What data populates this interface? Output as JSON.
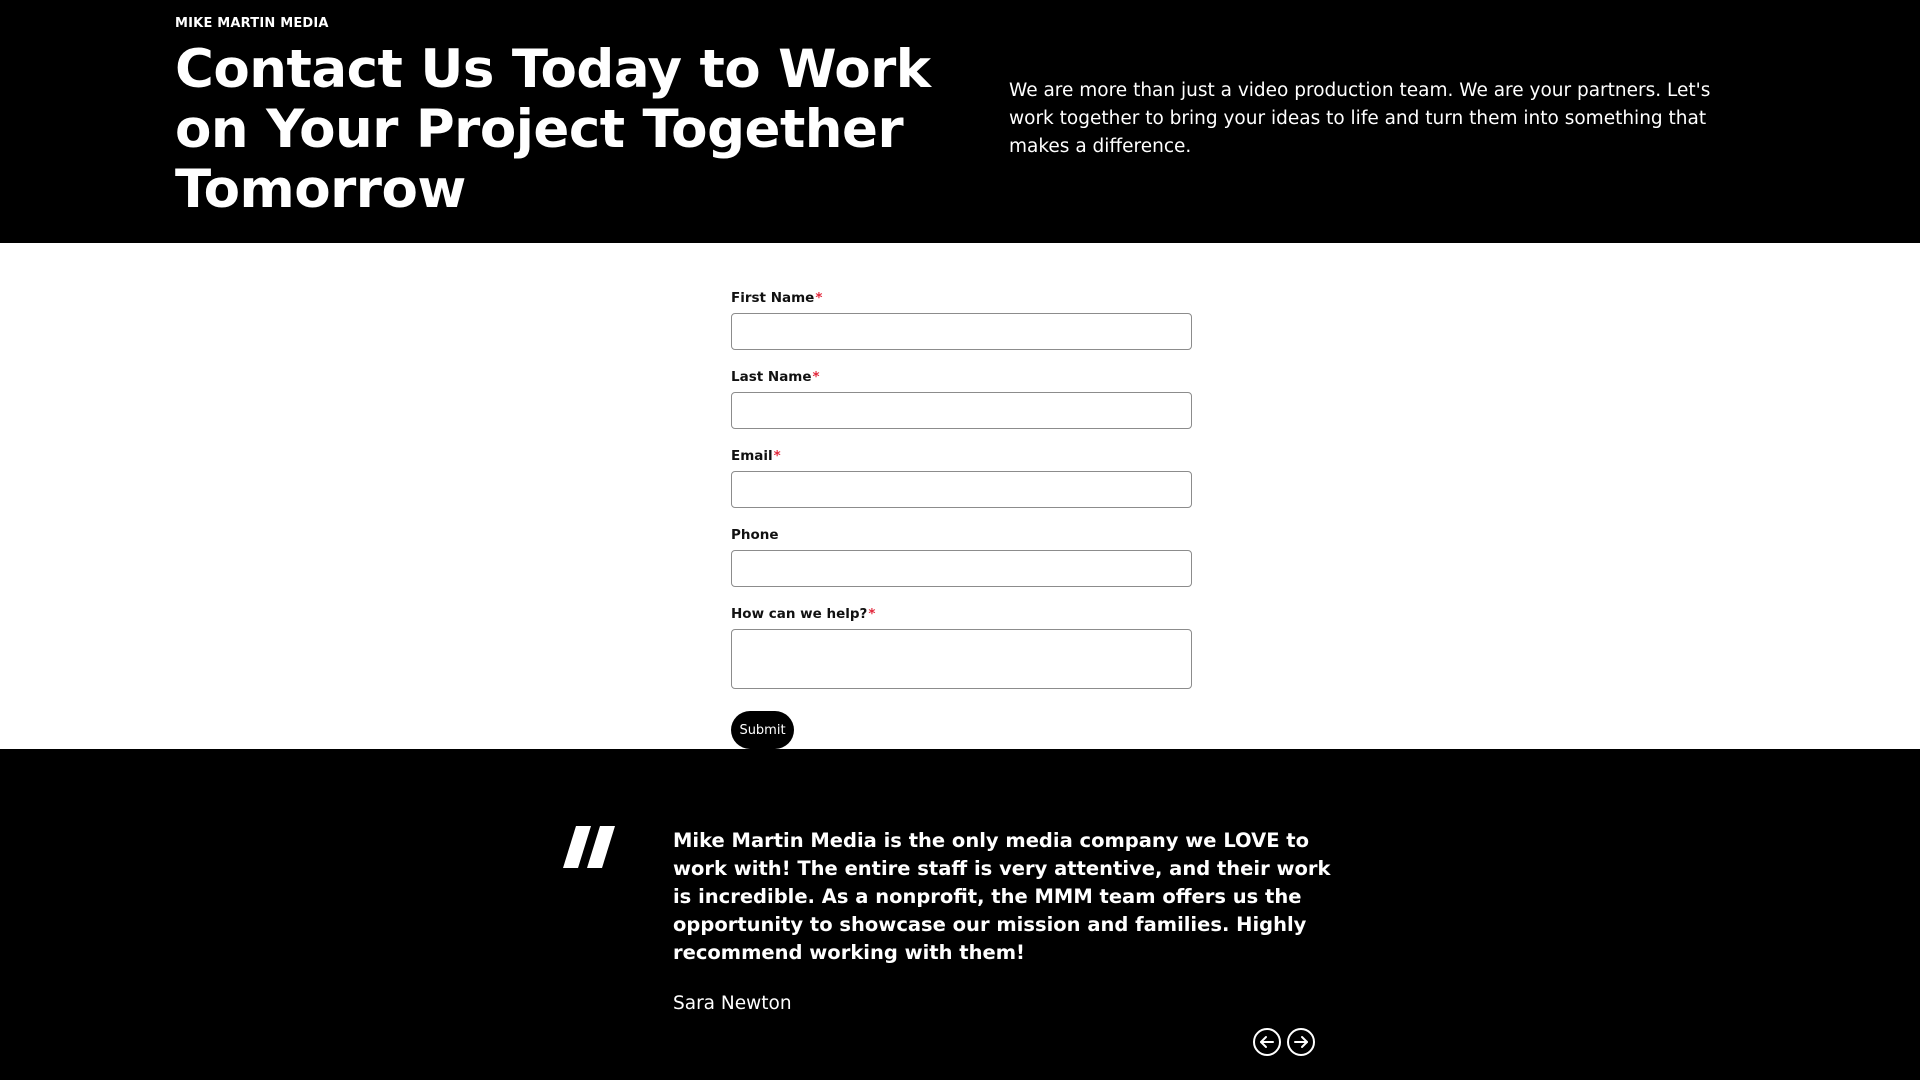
{
  "hero": {
    "brand": "MIKE MARTIN MEDIA",
    "title": "Contact Us Today to Work on Your Project Together Tomorrow",
    "description": "We are more than just a video production team. We are your partners. Let's work together to bring your ideas to life and turn them into something that makes a difference."
  },
  "form": {
    "first_name_label": "First Name",
    "last_name_label": "Last Name",
    "email_label": "Email",
    "phone_label": "Phone",
    "help_label": "How can we help?",
    "required_mark": "*",
    "first_name_value": "",
    "last_name_value": "",
    "email_value": "",
    "phone_value": "",
    "help_value": "",
    "submit_label": "Submit"
  },
  "testimonial": {
    "quote_icon": "quote-mark-icon",
    "quote": "Mike Martin Media is the only media company we LOVE to work with! The entire staff is very attentive, and their work is incredible. As a nonprofit, the MMM team offers us the opportunity to showcase our mission and families. Highly recommend working with them!",
    "author": "Sara Newton",
    "prev_icon": "arrow-left-circle-icon",
    "next_icon": "arrow-right-circle-icon"
  },
  "colors": {
    "dark_background": "#000000",
    "light_background": "#ffffff",
    "text_light": "#ffffff",
    "text_dark": "#111111",
    "required_accent": "#e2263a",
    "input_border": "#8c8c8c"
  }
}
